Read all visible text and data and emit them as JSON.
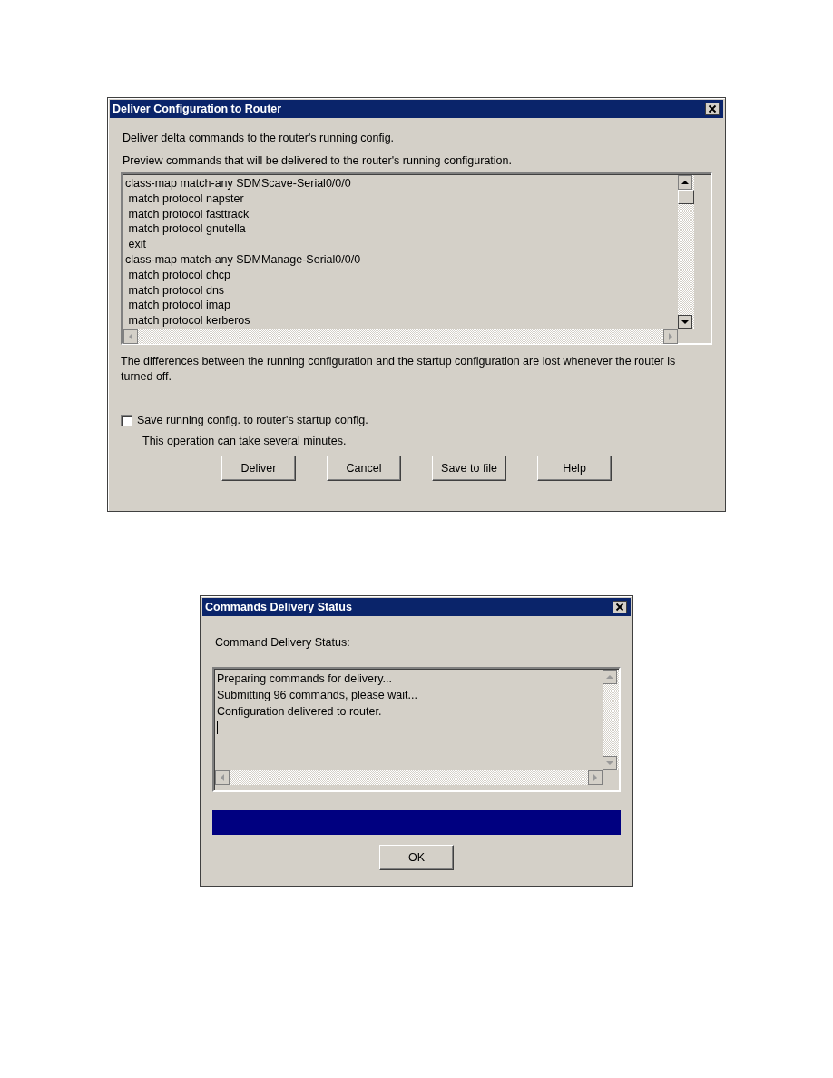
{
  "deliver_dialog": {
    "title": "Deliver Configuration to Router",
    "intro": "Deliver delta commands to the router's running config.",
    "preview_label": "Preview commands that will be delivered to the router's running configuration.",
    "commands": [
      "class-map match-any SDMScave-Serial0/0/0",
      " match protocol napster",
      " match protocol fasttrack",
      " match protocol gnutella",
      " exit",
      "class-map match-any SDMManage-Serial0/0/0",
      " match protocol dhcp",
      " match protocol dns",
      " match protocol imap",
      " match protocol kerberos"
    ],
    "warning": "The differences between the running configuration and the startup configuration are lost whenever the router is turned off.",
    "save_checkbox": {
      "label": "Save running config. to router's startup config.",
      "checked": false
    },
    "note": "This operation can take several minutes.",
    "buttons": [
      "Deliver",
      "Cancel",
      "Save to file",
      "Help"
    ]
  },
  "status_dialog": {
    "title": "Commands Delivery Status",
    "label": "Command Delivery Status:",
    "log": [
      "Preparing commands for delivery...",
      "Submitting 96 commands, please wait...",
      "Configuration delivered to router."
    ],
    "progress": {
      "level": 1
    },
    "buttons": [
      "OK"
    ]
  }
}
